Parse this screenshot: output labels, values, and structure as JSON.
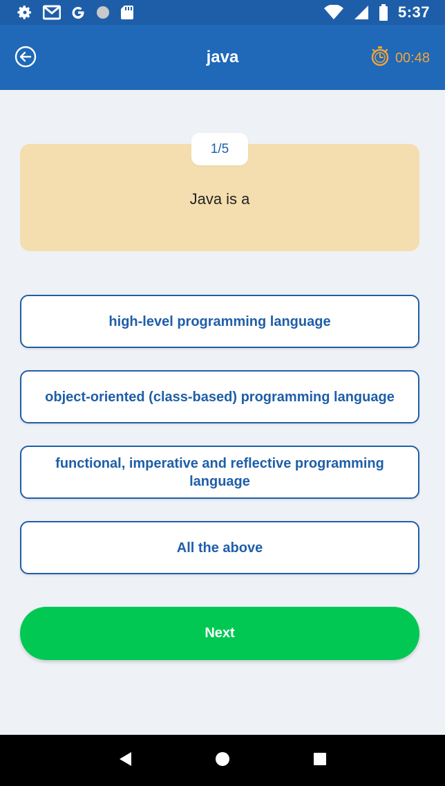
{
  "status_bar": {
    "time": "5:37",
    "icons": [
      "settings-icon",
      "gmail-icon",
      "google-icon",
      "circle-icon",
      "sd-card-icon",
      "wifi-icon",
      "signal-icon",
      "battery-icon"
    ]
  },
  "app_bar": {
    "title": "java",
    "timer": "00:48",
    "back_icon": "back-arrow-icon",
    "timer_icon": "stopwatch-icon"
  },
  "question": {
    "progress": "1/5",
    "text": "Java is a"
  },
  "options": [
    {
      "label": "high-level programming language"
    },
    {
      "label": "object-oriented (class-based) programming language"
    },
    {
      "label": "functional, imperative and reflective programming language"
    },
    {
      "label": "All the above"
    }
  ],
  "next_button": {
    "label": "Next"
  },
  "nav_bar": {
    "icons": [
      "back-triangle-icon",
      "home-circle-icon",
      "recents-square-icon"
    ]
  },
  "colors": {
    "app_bar": "#1f69b8",
    "accent": "#1f5ea8",
    "timer": "#f2a53a",
    "card": "#f4deaf",
    "next": "#00c853",
    "background": "#eef1f6"
  }
}
